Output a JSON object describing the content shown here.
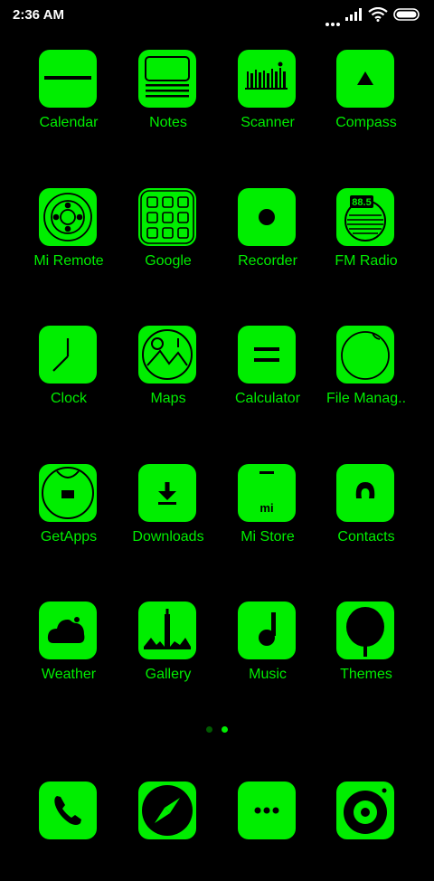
{
  "status_bar": {
    "time": "2:36 AM"
  },
  "colors": {
    "accent": "#00ee00",
    "background": "#000000",
    "icon_ink": "#000000"
  },
  "home_grid": [
    [
      {
        "label": "Calendar",
        "icon": "calendar-icon"
      },
      {
        "label": "Notes",
        "icon": "notes-icon"
      },
      {
        "label": "Scanner",
        "icon": "scanner-icon"
      },
      {
        "label": "Compass",
        "icon": "compass-icon"
      }
    ],
    [
      {
        "label": "Mi Remote",
        "icon": "remote-icon"
      },
      {
        "label": "Google",
        "icon": "google-folder-icon"
      },
      {
        "label": "Recorder",
        "icon": "recorder-icon"
      },
      {
        "label": "FM Radio",
        "icon": "radio-icon",
        "readout": "88.5"
      }
    ],
    [
      {
        "label": "Clock",
        "icon": "clock-icon"
      },
      {
        "label": "Maps",
        "icon": "maps-icon"
      },
      {
        "label": "Calculator",
        "icon": "calculator-icon"
      },
      {
        "label": "File Manag..",
        "icon": "file-manager-icon"
      }
    ],
    [
      {
        "label": "GetApps",
        "icon": "getapps-icon"
      },
      {
        "label": "Downloads",
        "icon": "download-icon"
      },
      {
        "label": "Mi Store",
        "icon": "store-icon",
        "logo": "mi"
      },
      {
        "label": "Contacts",
        "icon": "contacts-icon"
      }
    ],
    [
      {
        "label": "Weather",
        "icon": "weather-icon"
      },
      {
        "label": "Gallery",
        "icon": "gallery-icon"
      },
      {
        "label": "Music",
        "icon": "music-icon"
      },
      {
        "label": "Themes",
        "icon": "themes-icon"
      }
    ]
  ],
  "page_indicator": {
    "pages": 2,
    "active_page": 2
  },
  "dock": [
    {
      "icon": "phone-icon"
    },
    {
      "icon": "browser-icon"
    },
    {
      "icon": "more-icon"
    },
    {
      "icon": "camera-icon"
    }
  ]
}
